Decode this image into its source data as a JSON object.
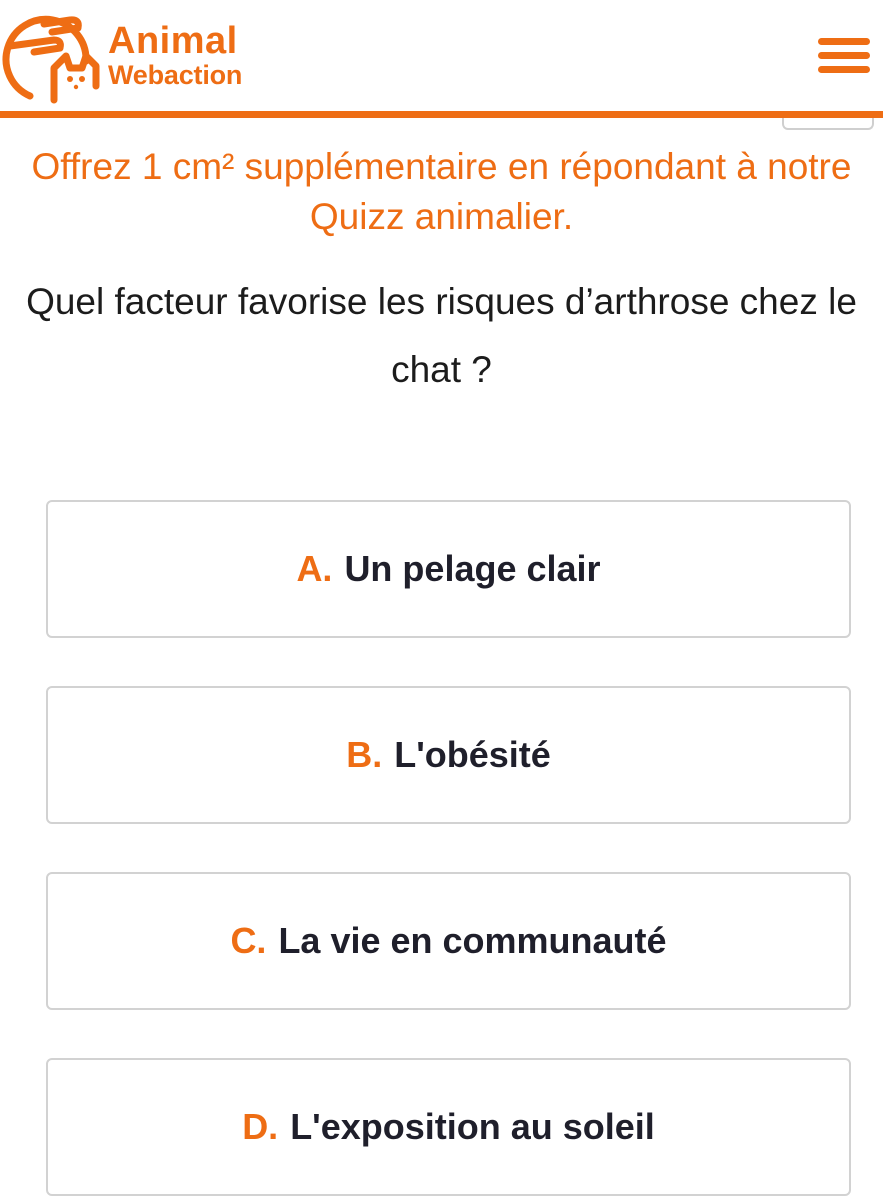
{
  "colors": {
    "accent": "#ee6d14",
    "text": "#1f1f2b",
    "border": "#d2d2d2"
  },
  "header": {
    "logo_line1": "Animal",
    "logo_line2": "Webaction",
    "menu_icon": "hamburger-menu-icon"
  },
  "promo": {
    "text": "Offrez 1 cm² supplémentaire en répondant à notre Quizz animalier."
  },
  "quiz": {
    "question": "Quel facteur favorise les risques d’arthrose chez le chat ?",
    "answers": [
      {
        "letter": "A.",
        "label": "Un pelage clair"
      },
      {
        "letter": "B.",
        "label": "L'obésité"
      },
      {
        "letter": "C.",
        "label": "La vie en communauté"
      },
      {
        "letter": "D.",
        "label": "L'exposition au soleil"
      }
    ]
  }
}
